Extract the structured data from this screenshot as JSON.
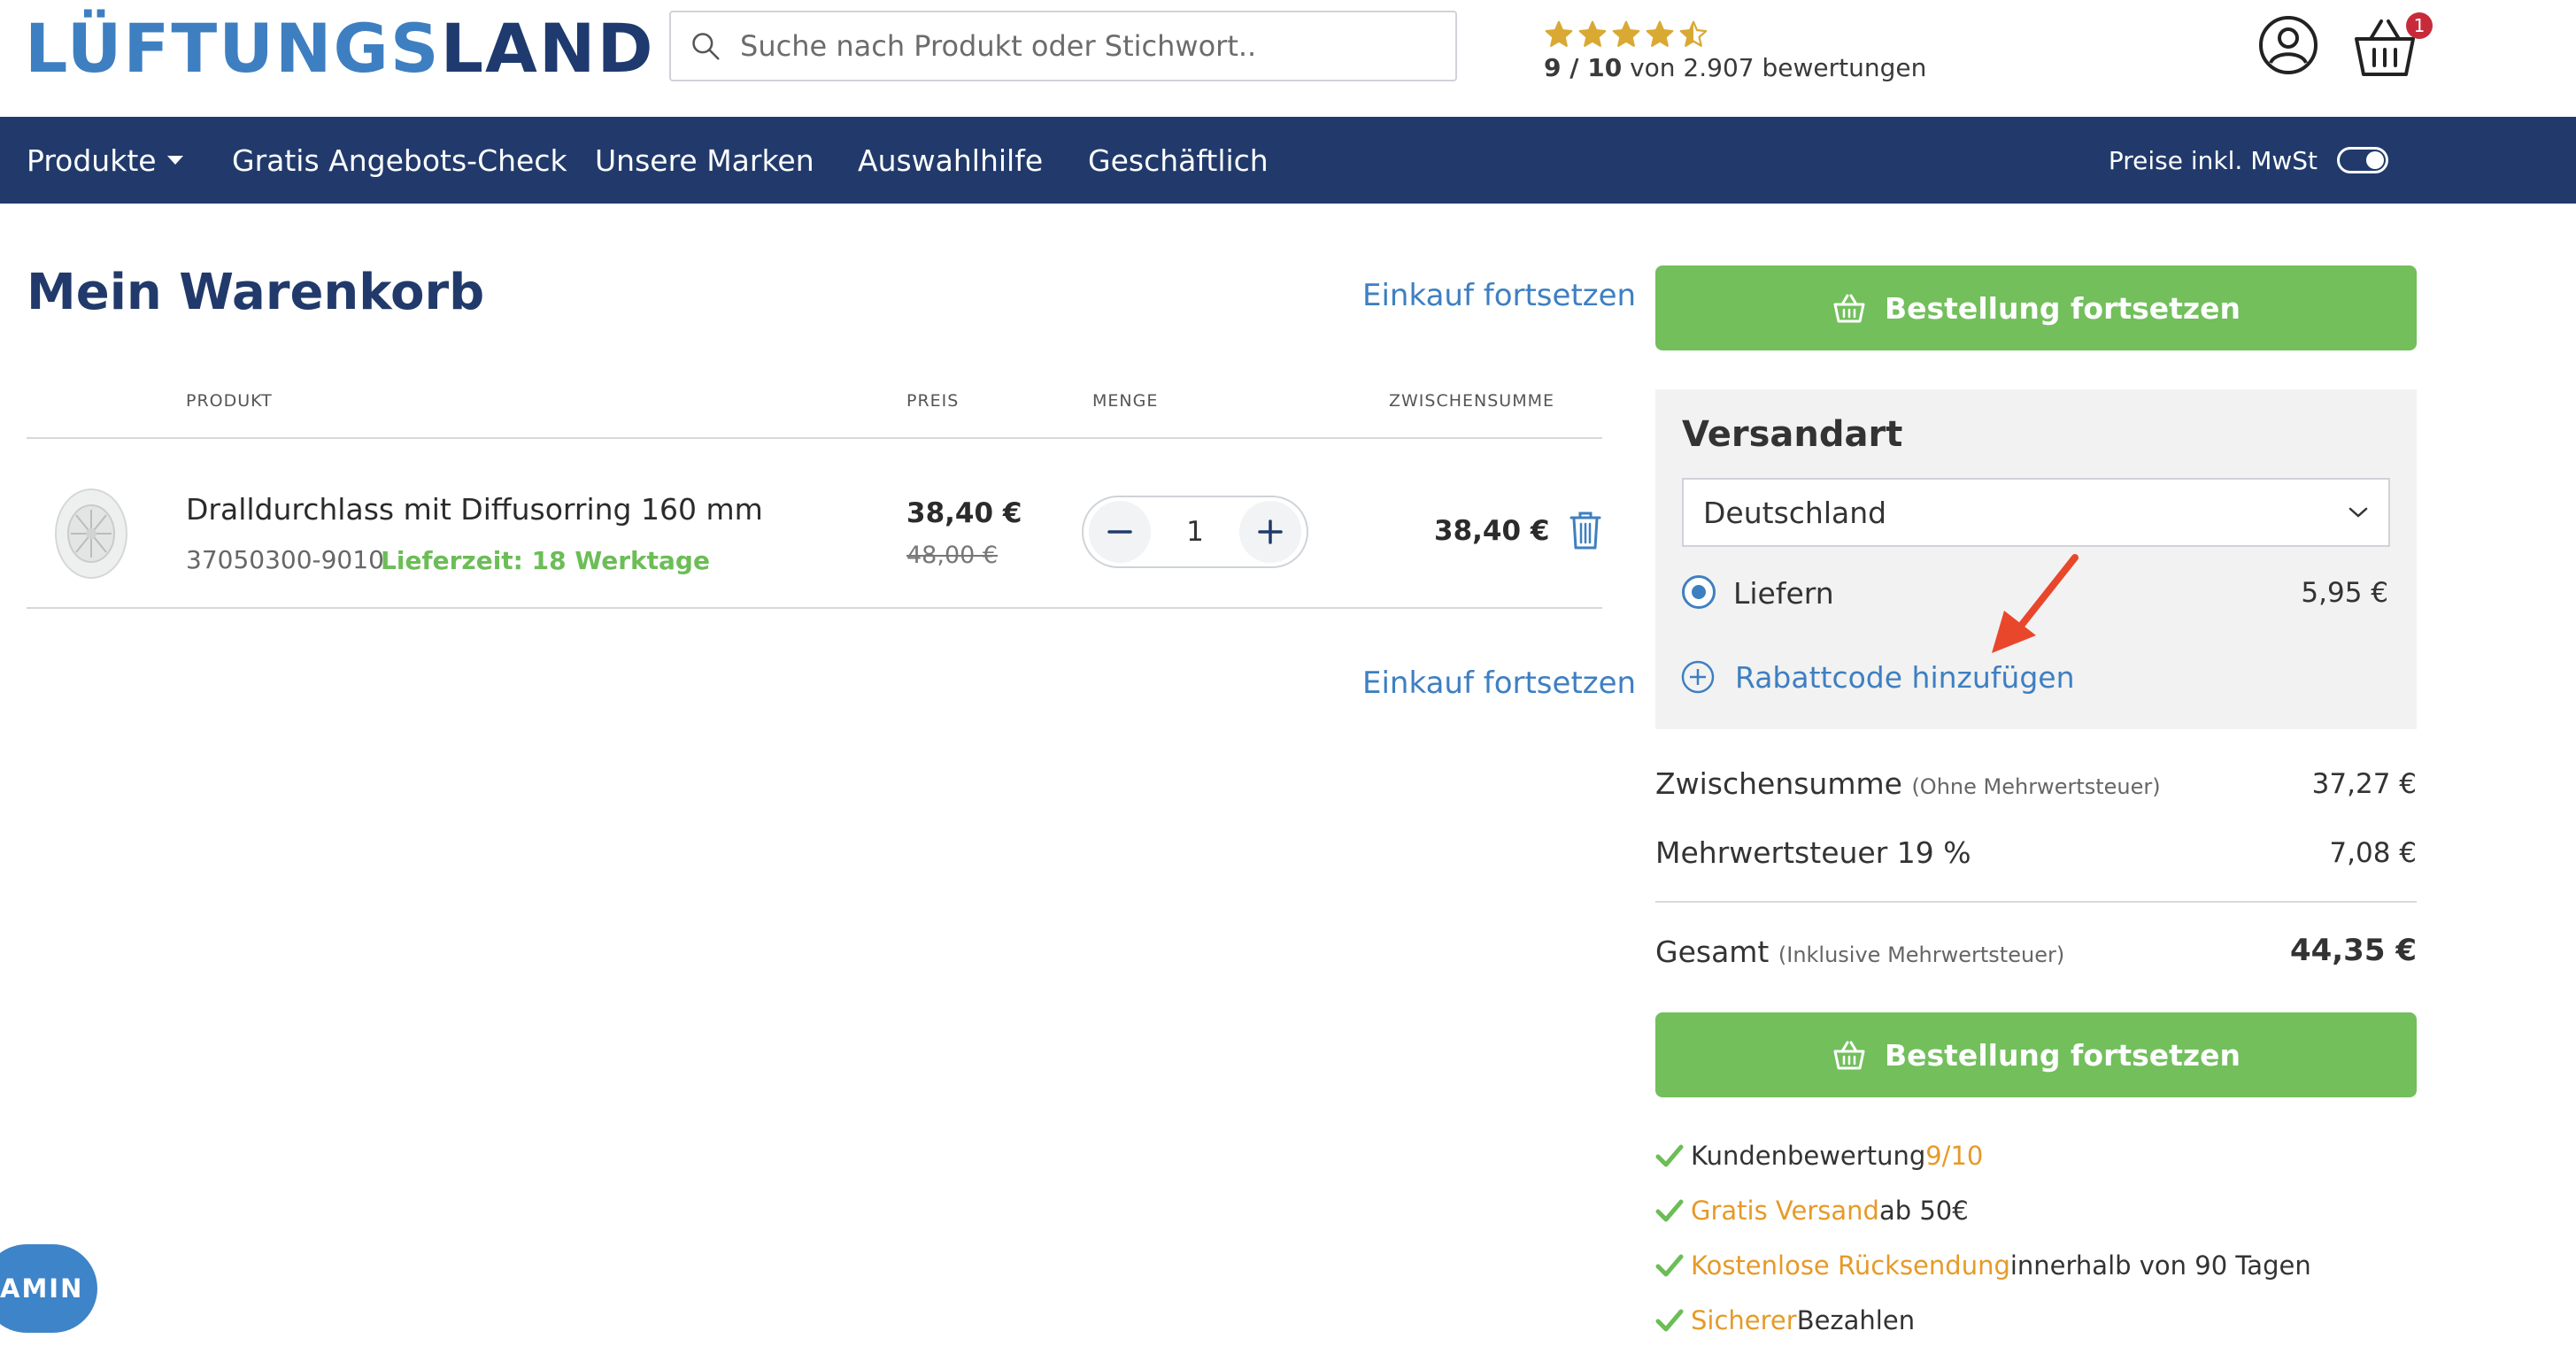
{
  "header": {
    "logo_part1": "LÜFTUNGS",
    "logo_part2": "LAND",
    "search_placeholder": "Suche nach Produkt oder Stichwort..",
    "rating_score": "9 / 10",
    "rating_text": " von 2.907 bewertungen",
    "rating_stars": 4.5,
    "basket_count": "1"
  },
  "nav": {
    "items": [
      "Produkte",
      "Gratis Angebots-Check",
      "Unsere Marken",
      "Auswahlhilfe",
      "Geschäftlich"
    ],
    "vat_label": "Preise inkl. MwSt"
  },
  "cart": {
    "title": "Mein Warenkorb",
    "continue_link": "Einkauf fortsetzen",
    "columns": {
      "product": "PRODUKT",
      "price": "PREIS",
      "qty": "MENGE",
      "subtotal": "ZWISCHENSUMME"
    },
    "item": {
      "name": "Dralldurchlass mit Diffusorring 160 mm",
      "sku": "37050300-9010",
      "delivery": "Lieferzeit: 18 Werktage",
      "price": "38,40 €",
      "price_old": "48,00 €",
      "qty": "1",
      "subtotal": "38,40 €"
    }
  },
  "summary": {
    "checkout_button": "Bestellung fortsetzen",
    "shipping_title": "Versandart",
    "country": "Deutschland",
    "deliver_label": "Liefern",
    "deliver_price": "5,95 €",
    "coupon_link": "Rabattcode hinzufügen",
    "subtotal_label": "Zwischensumme",
    "subtotal_note": "(Ohne Mehrwertsteuer)",
    "subtotal_value": "37,27 €",
    "vat_label": "Mehrwertsteuer 19 %",
    "vat_value": "7,08 €",
    "total_label": "Gesamt",
    "total_note": "(Inklusive Mehrwertsteuer)",
    "total_value": "44,35 €"
  },
  "usps": [
    {
      "pre": "Kundenbewertung ",
      "hl": "9/10",
      "post": ""
    },
    {
      "pre": "",
      "hl": "Gratis Versand",
      "post": " ab 50€"
    },
    {
      "pre": "",
      "hl": "Kostenlose Rücksendung",
      "post": " innerhalb von 90 Tagen"
    },
    {
      "pre": "",
      "hl": "Sicherer",
      "post": " Bezahlen"
    }
  ],
  "floating_pill": "AMIN",
  "colors": {
    "navy": "#213a6b",
    "blue": "#3e7fc1",
    "green": "#72bf5c",
    "orange": "#e69a28",
    "star": "#d9a934",
    "badge": "#c72b3a",
    "arrow": "#e8472c"
  }
}
